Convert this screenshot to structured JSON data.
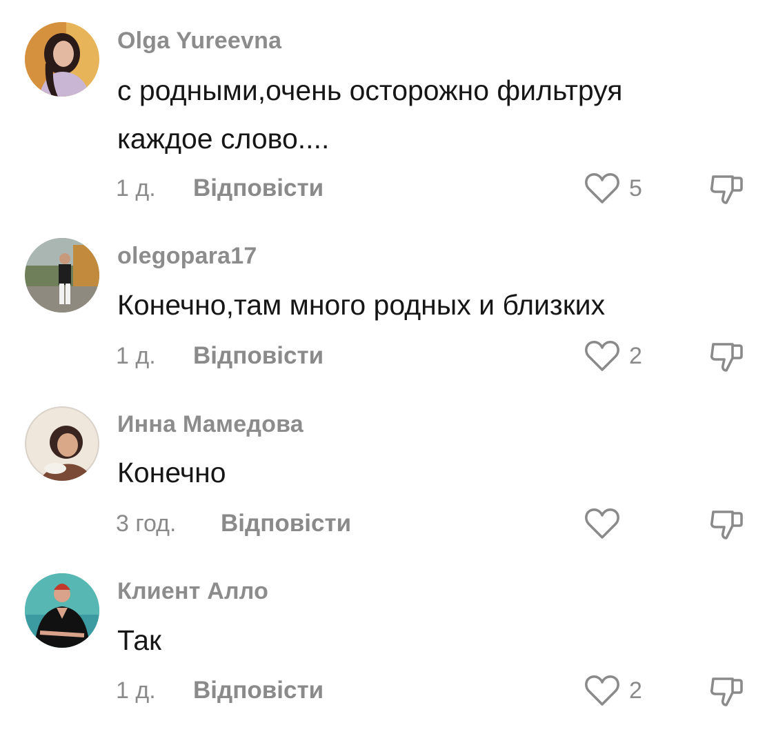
{
  "comments": [
    {
      "username": "Olga Yureevna",
      "text": "с родными,очень осторожно фильтруя каждое слово....",
      "time": "1 д.",
      "reply_label": "Відповісти",
      "likes": "5",
      "avatar": "avatar-woman-pink"
    },
    {
      "username": "olegopara17",
      "text": "Конечно,там много родных и близких",
      "time": "1 д.",
      "reply_label": "Відповісти",
      "likes": "2",
      "avatar": "avatar-man-outdoors"
    },
    {
      "username": "Инна Мамедова",
      "text": "Конечно",
      "time": "3 год.",
      "reply_label": "Відповісти",
      "likes": "",
      "avatar": "avatar-woman-light"
    },
    {
      "username": "Клиент Алло",
      "text": "Так",
      "time": "1 д.",
      "reply_label": "Відповісти",
      "likes": "2",
      "avatar": "avatar-woman-dark"
    }
  ],
  "icons": {
    "like": "heart-outline-icon",
    "dislike": "thumbs-down-icon"
  },
  "colors": {
    "muted_text": "#8a8a8a",
    "body_text": "#161616",
    "icon_stroke": "#8a8a8a"
  }
}
